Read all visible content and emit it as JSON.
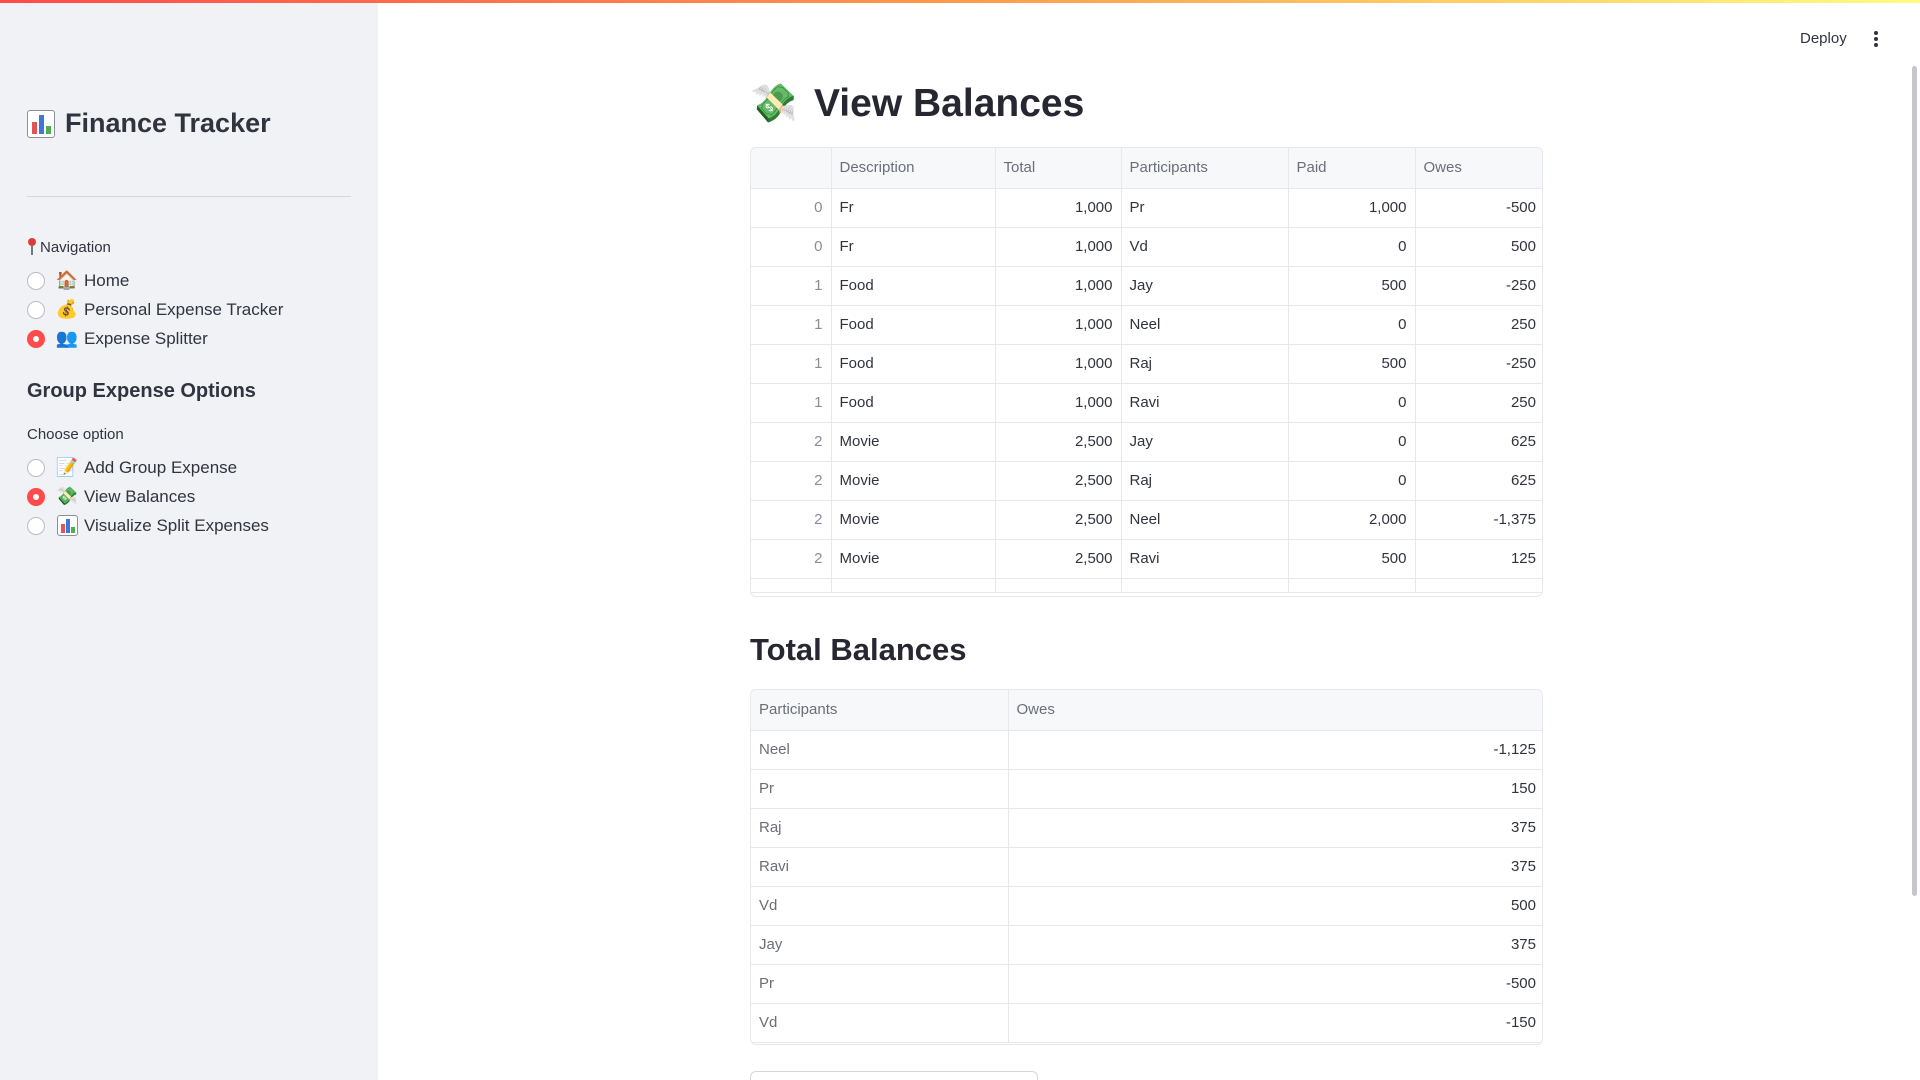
{
  "sidebar": {
    "app_title": "Finance Tracker",
    "navigation_label": "Navigation",
    "nav_items": [
      {
        "label": "Home",
        "icon": "house-icon",
        "selected": false
      },
      {
        "label": "Personal Expense Tracker",
        "icon": "money-bag-icon",
        "selected": false
      },
      {
        "label": "Expense Splitter",
        "icon": "people-icon",
        "selected": true
      }
    ],
    "group_heading": "Group Expense Options",
    "choose_label": "Choose option",
    "options": [
      {
        "label": "Add Group Expense",
        "icon": "memo-icon",
        "selected": false
      },
      {
        "label": "View Balances",
        "icon": "money-with-wings-icon",
        "selected": true
      },
      {
        "label": "Visualize Split Expenses",
        "icon": "bar-chart-icon",
        "selected": false
      }
    ]
  },
  "header": {
    "deploy_label": "Deploy"
  },
  "main": {
    "page_title": "View Balances",
    "expenses_table": {
      "columns": [
        "",
        "Description",
        "Total",
        "Participants",
        "Paid",
        "Owes"
      ],
      "rows": [
        [
          "0",
          "Fr",
          "1,000",
          "Pr",
          "1,000",
          "-500"
        ],
        [
          "0",
          "Fr",
          "1,000",
          " Vd",
          "0",
          "500"
        ],
        [
          "1",
          "Food",
          "1,000",
          "Jay",
          "500",
          "-250"
        ],
        [
          "1",
          "Food",
          "1,000",
          " Neel",
          "0",
          "250"
        ],
        [
          "1",
          "Food",
          "1,000",
          " Raj",
          "500",
          "-250"
        ],
        [
          "1",
          "Food",
          "1,000",
          " Ravi",
          "0",
          "250"
        ],
        [
          "2",
          "Movie",
          "2,500",
          "Jay",
          "0",
          "625"
        ],
        [
          "2",
          "Movie",
          "2,500",
          " Raj",
          "0",
          "625"
        ],
        [
          "2",
          "Movie",
          "2,500",
          " Neel",
          "2,000",
          "-1,375"
        ],
        [
          "2",
          "Movie",
          "2,500",
          " Ravi",
          "500",
          "125"
        ]
      ]
    },
    "total_title": "Total Balances",
    "totals_table": {
      "columns": [
        "Participants",
        "Owes"
      ],
      "rows": [
        [
          " Neel",
          "-1,125"
        ],
        [
          "Pr",
          "150"
        ],
        [
          " Raj",
          "375"
        ],
        [
          " Ravi",
          "375"
        ],
        [
          " Vd",
          "500"
        ],
        [
          "Jay",
          "375"
        ],
        [
          "Pr",
          "-500"
        ],
        [
          "Vd",
          "-150"
        ]
      ]
    }
  },
  "colors": {
    "accent": "#ff4b4b",
    "sidebar_bg": "#f0f2f6",
    "text": "#31333f"
  }
}
